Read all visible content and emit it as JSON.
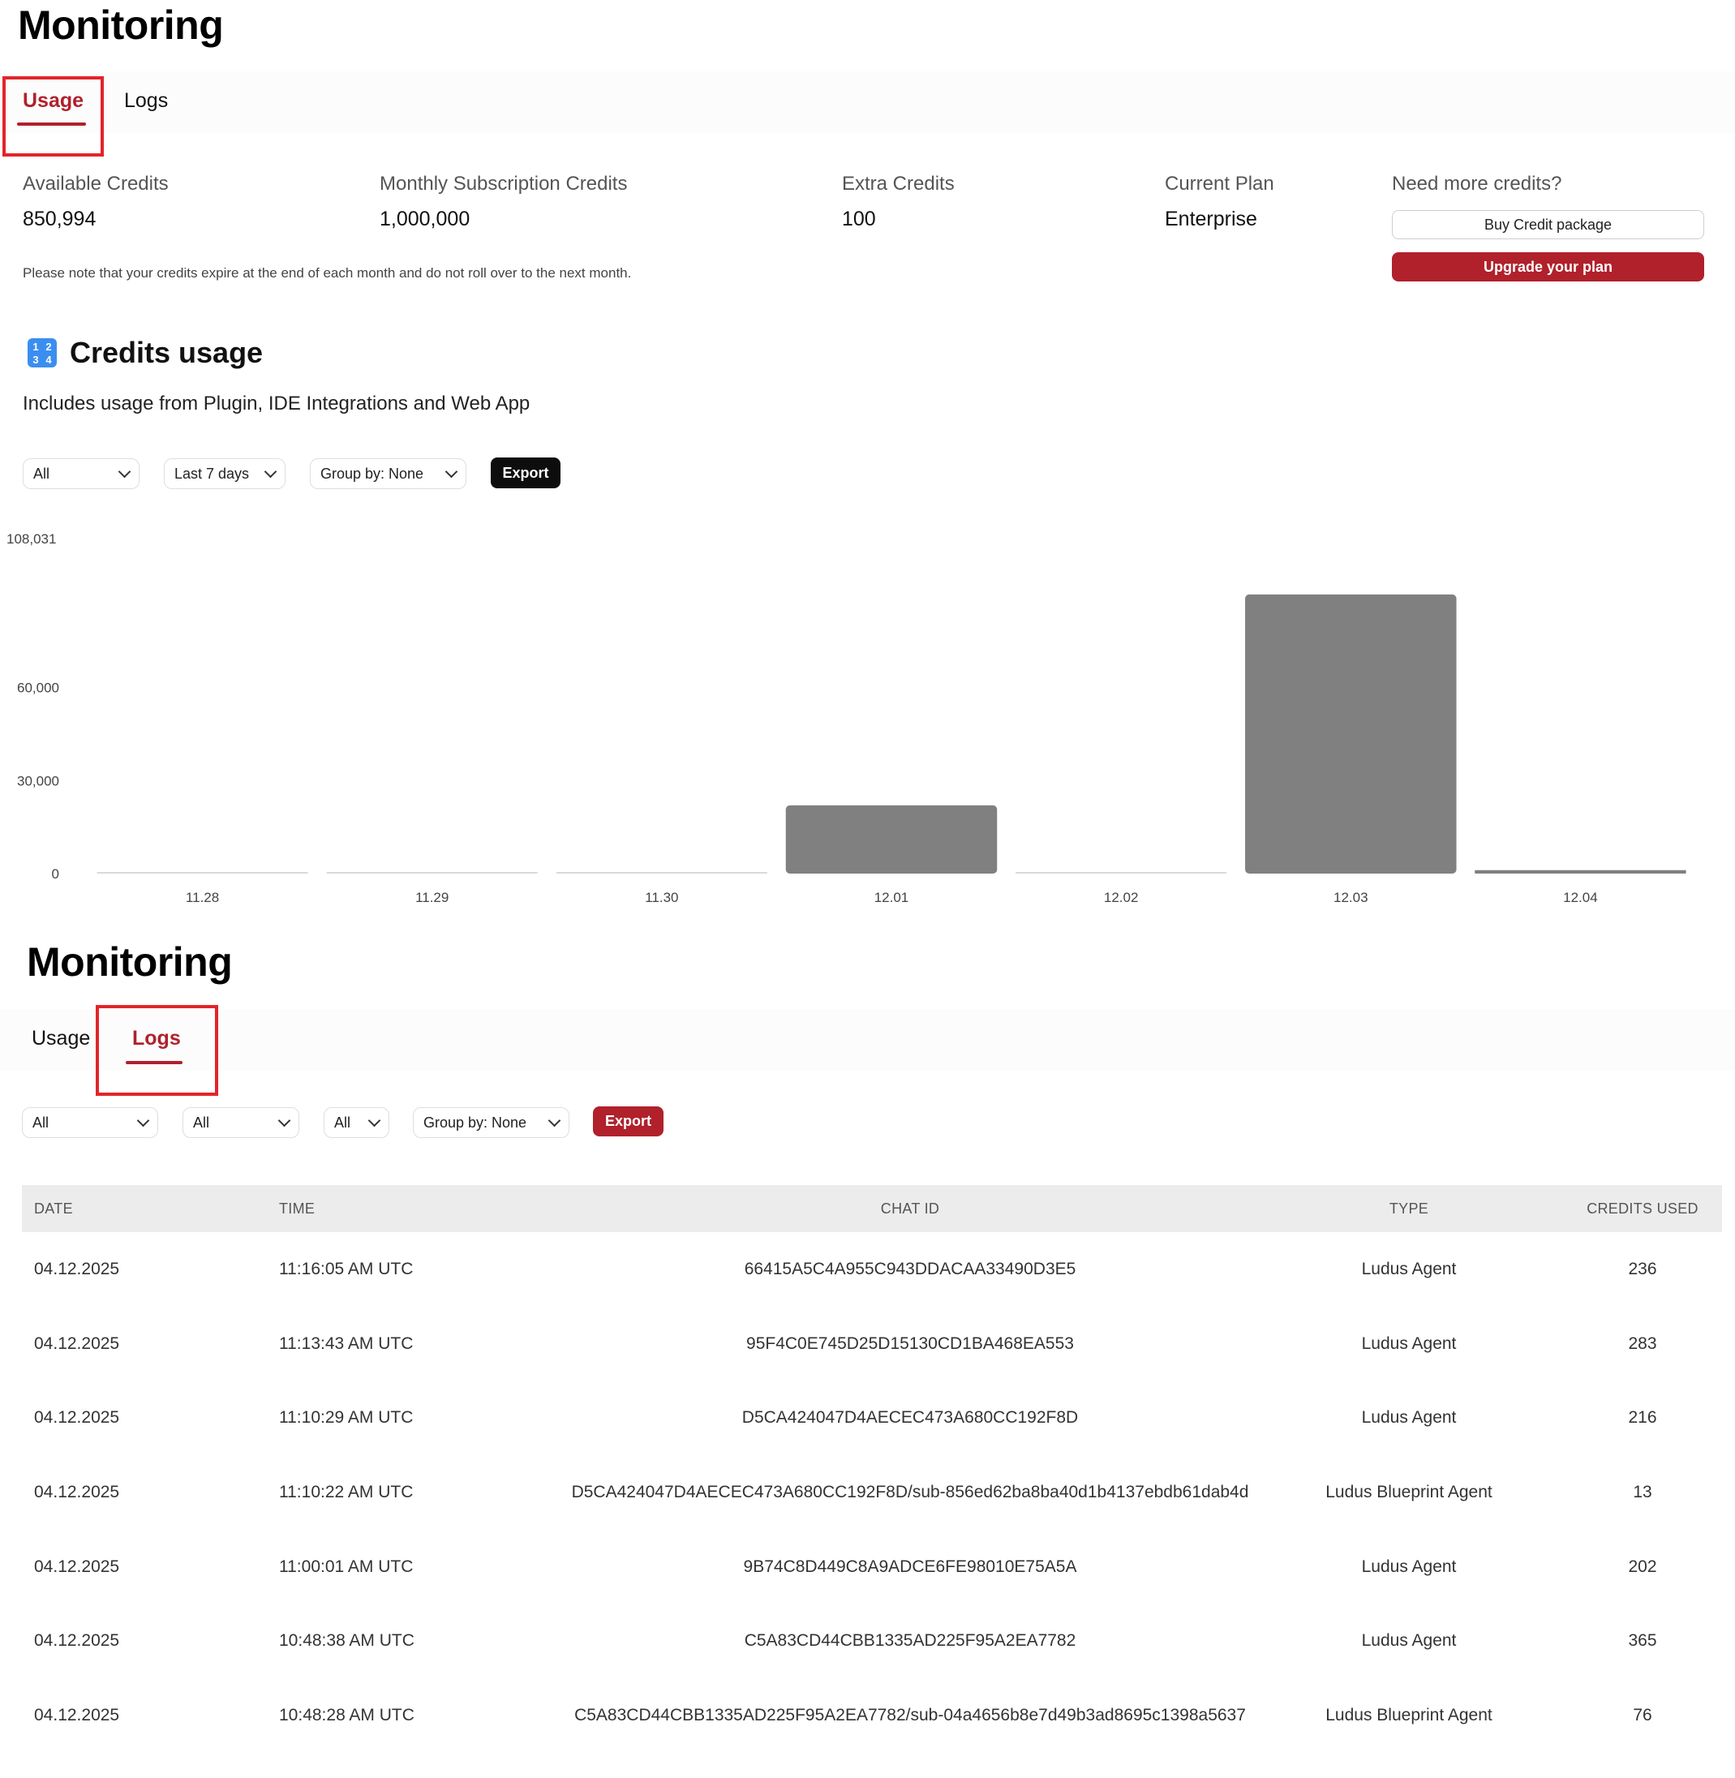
{
  "usage_view": {
    "title": "Monitoring",
    "tabs": [
      {
        "label": "Usage",
        "active": true
      },
      {
        "label": "Logs",
        "active": false
      }
    ],
    "stats": [
      {
        "label": "Available Credits",
        "value": "850,994"
      },
      {
        "label": "Monthly Subscription Credits",
        "value": "1,000,000"
      },
      {
        "label": "Extra Credits",
        "value": "100"
      },
      {
        "label": "Current Plan",
        "value": "Enterprise"
      }
    ],
    "need_more": {
      "label": "Need more credits?",
      "buy_label": "Buy Credit package",
      "upgrade_label": "Upgrade your plan"
    },
    "note": "Please note that your credits expire at the end of each month and do not roll over to the next month.",
    "credits_section": {
      "title": "Credits usage",
      "icon": "input-numbers-icon",
      "subtitle": "Includes usage from Plugin, IDE Integrations and Web App"
    },
    "filters": {
      "source": "All",
      "range": "Last 7 days",
      "group_by": "Group by: None",
      "export_label": "Export"
    }
  },
  "chart_data": {
    "type": "bar",
    "categories": [
      "11.28",
      "11.29",
      "11.30",
      "12.01",
      "12.02",
      "12.03",
      "12.04"
    ],
    "values": [
      0,
      0,
      0,
      22000,
      0,
      90000,
      1100
    ],
    "y_ticks": [
      "0",
      "30,000",
      "60,000",
      "108,031"
    ],
    "y_tick_values": [
      0,
      30000,
      60000,
      108031
    ],
    "ylim": [
      0,
      108031
    ],
    "bar_color": "#808080",
    "grid": false
  },
  "logs_view": {
    "title": "Monitoring",
    "tabs": [
      {
        "label": "Usage",
        "active": false
      },
      {
        "label": "Logs",
        "active": true
      }
    ],
    "filters": {
      "filter1": "All",
      "filter2": "All",
      "filter3": "All",
      "group_by": "Group by: None",
      "export_label": "Export"
    },
    "columns": [
      "DATE",
      "TIME",
      "CHAT ID",
      "TYPE",
      "CREDITS USED"
    ],
    "rows": [
      {
        "date": "04.12.2025",
        "time": "11:16:05 AM UTC",
        "chat_id": "66415A5C4A955C943DDACAA33490D3E5",
        "type": "Ludus Agent",
        "credits": "236"
      },
      {
        "date": "04.12.2025",
        "time": "11:13:43 AM UTC",
        "chat_id": "95F4C0E745D25D15130CD1BA468EA553",
        "type": "Ludus Agent",
        "credits": "283"
      },
      {
        "date": "04.12.2025",
        "time": "11:10:29 AM UTC",
        "chat_id": "D5CA424047D4AECEC473A680CC192F8D",
        "type": "Ludus Agent",
        "credits": "216"
      },
      {
        "date": "04.12.2025",
        "time": "11:10:22 AM UTC",
        "chat_id": "D5CA424047D4AECEC473A680CC192F8D/sub-856ed62ba8ba40d1b4137ebdb61dab4d",
        "type": "Ludus Blueprint Agent",
        "credits": "13"
      },
      {
        "date": "04.12.2025",
        "time": "11:00:01 AM UTC",
        "chat_id": "9B74C8D449C8A9ADCE6FE98010E75A5A",
        "type": "Ludus Agent",
        "credits": "202"
      },
      {
        "date": "04.12.2025",
        "time": "10:48:38 AM UTC",
        "chat_id": "C5A83CD44CBB1335AD225F95A2EA7782",
        "type": "Ludus Agent",
        "credits": "365"
      },
      {
        "date": "04.12.2025",
        "time": "10:48:28 AM UTC",
        "chat_id": "C5A83CD44CBB1335AD225F95A2EA7782/sub-04a4656b8e7d49b3ad8695c1398a5637",
        "type": "Ludus Blueprint Agent",
        "credits": "76"
      }
    ]
  },
  "colors": {
    "accent": "#b0212b",
    "highlight": "#e3242b",
    "dark_button": "#0d0d0d"
  }
}
